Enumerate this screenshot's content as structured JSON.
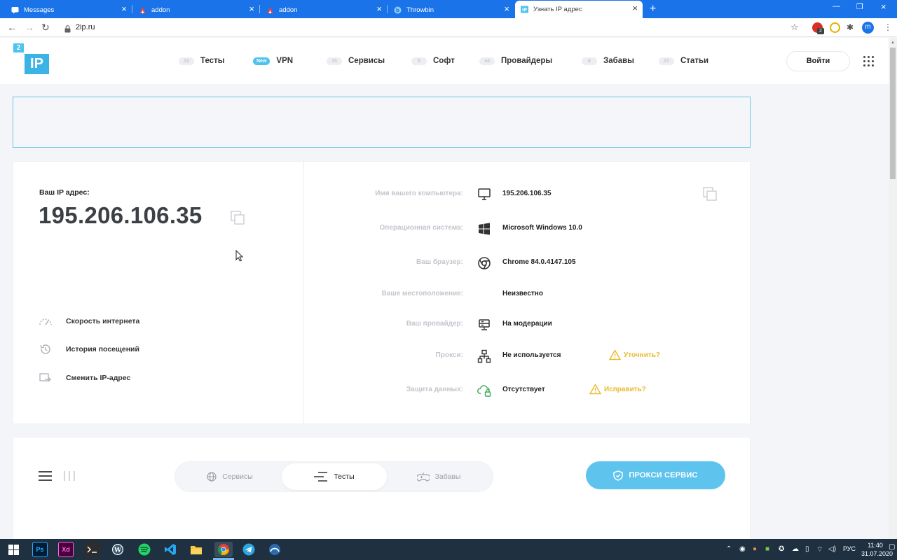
{
  "browser": {
    "tabs": [
      {
        "title": "Messages",
        "active": false
      },
      {
        "title": "addon",
        "active": false
      },
      {
        "title": "addon",
        "active": false
      },
      {
        "title": "Throwbin",
        "active": false
      },
      {
        "title": "Узнать IP адрес",
        "active": true
      }
    ],
    "url": "2ip.ru",
    "profile_initial": "m",
    "extension_badge": "2"
  },
  "site": {
    "logo_top": "2",
    "logo_main": "IP",
    "nav": [
      {
        "badge": "32",
        "label": "Тесты"
      },
      {
        "badge": "New",
        "label": "VPN"
      },
      {
        "badge": "15",
        "label": "Сервисы"
      },
      {
        "badge": "5",
        "label": "Софт"
      },
      {
        "badge": "44",
        "label": "Провайдеры"
      },
      {
        "badge": "6",
        "label": "Забавы"
      },
      {
        "badge": "37",
        "label": "Статьи"
      }
    ],
    "login": "Войти"
  },
  "ip_card": {
    "label": "Ваш IP адрес:",
    "ip": "195.206.106.35",
    "links": [
      "Скорость интернета",
      "История посещений",
      "Сменить IP-адрес"
    ],
    "rows": [
      {
        "label": "Имя вашего компьютера:",
        "value": "195.206.106.35",
        "icon": "monitor-icon"
      },
      {
        "label": "Операционная система:",
        "value": "Microsoft Windows 10.0",
        "icon": "windows-icon"
      },
      {
        "label": "Ваш браузер:",
        "value": "Chrome 84.0.4147.105",
        "icon": "chrome-icon"
      },
      {
        "label": "Ваше местоположение:",
        "value": "Неизвестно",
        "icon": ""
      },
      {
        "label": "Ваш провайдер:",
        "value": "На модерации",
        "icon": "server-icon"
      },
      {
        "label": "Прокси:",
        "value": "Не используется",
        "icon": "network-icon",
        "action": "Уточнить?"
      },
      {
        "label": "Защита данных:",
        "value": "Отсутствует",
        "icon": "cloud-lock-icon",
        "action": "Исправить?"
      }
    ]
  },
  "tools": {
    "segments": [
      "Сервисы",
      "Тесты",
      "Забавы"
    ],
    "active_segment": "Тесты",
    "proxy_button": "ПРОКСИ СЕРВИС"
  },
  "taskbar": {
    "apps": [
      "Ps",
      "Xd"
    ],
    "language": "РУС",
    "time": "11:40",
    "date": "31.07.2020"
  },
  "colors": {
    "accent": "#4fc2ee",
    "chrome_blue": "#1a73e8",
    "warning": "#e9b92d",
    "taskbar": "#1f3040"
  }
}
